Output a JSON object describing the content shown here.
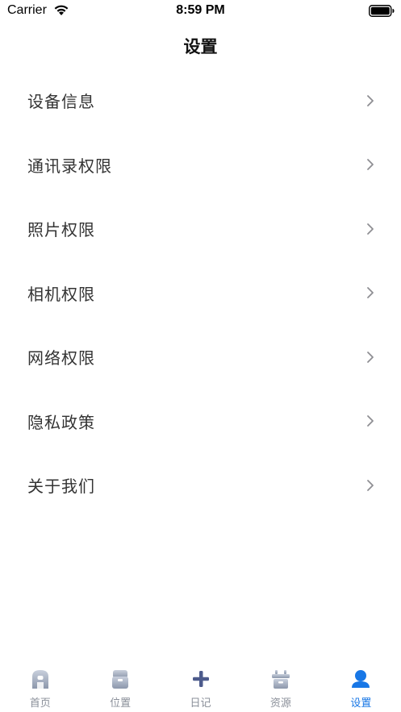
{
  "status_bar": {
    "carrier": "Carrier",
    "time": "8:59 PM"
  },
  "nav": {
    "title": "设置"
  },
  "settings": {
    "items": [
      {
        "label": "设备信息"
      },
      {
        "label": "通讯录权限"
      },
      {
        "label": "照片权限"
      },
      {
        "label": "相机权限"
      },
      {
        "label": "网络权限"
      },
      {
        "label": "隐私政策"
      },
      {
        "label": "关于我们"
      }
    ]
  },
  "tab_bar": {
    "active_color": "#1877e6",
    "inactive_color": "#8a8f99",
    "tabs": [
      {
        "label": "首页",
        "icon": "home-icon"
      },
      {
        "label": "位置",
        "icon": "location-icon"
      },
      {
        "label": "日记",
        "icon": "plus-icon"
      },
      {
        "label": "资源",
        "icon": "resources-icon"
      },
      {
        "label": "设置",
        "icon": "user-icon",
        "active": true
      }
    ]
  }
}
